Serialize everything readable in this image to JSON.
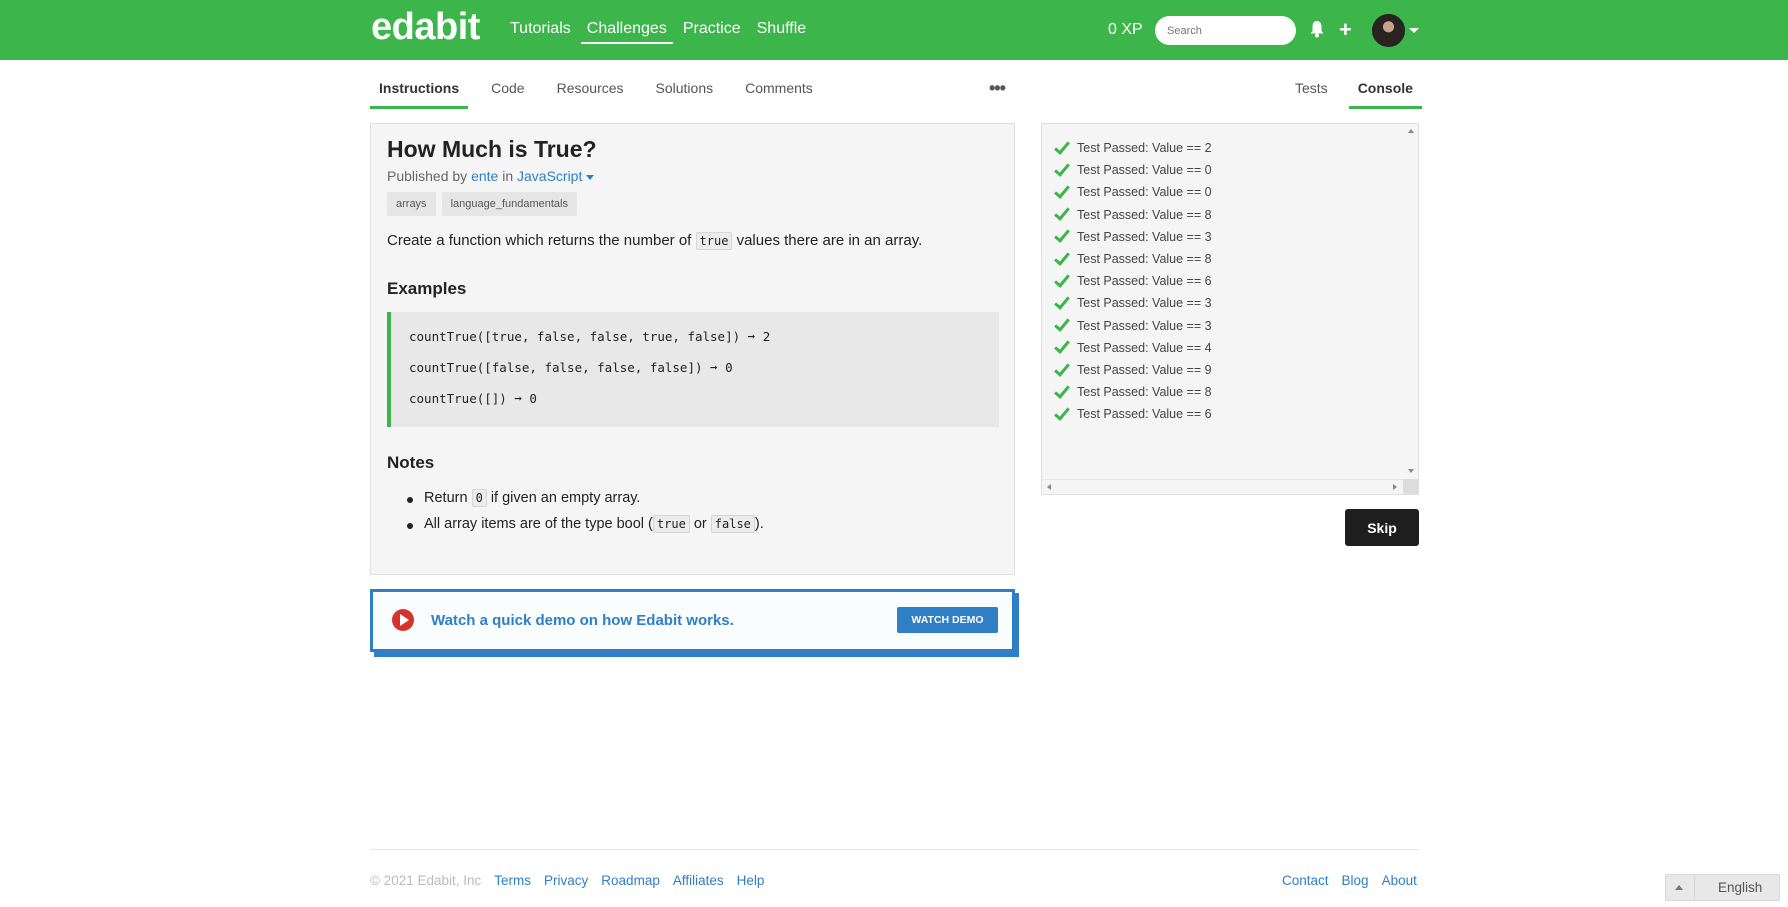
{
  "header": {
    "logo": "edabit",
    "nav": [
      {
        "label": "Tutorials"
      },
      {
        "label": "Challenges"
      },
      {
        "label": "Practice"
      },
      {
        "label": "Shuffle"
      }
    ],
    "active_nav": "Challenges",
    "xp": "0 XP",
    "search_placeholder": "Search",
    "plus": "+"
  },
  "tabs_left": [
    "Instructions",
    "Code",
    "Resources",
    "Solutions",
    "Comments"
  ],
  "tabs_right": [
    "Tests",
    "Console"
  ],
  "more": "•••",
  "challenge": {
    "title": "How Much is True?",
    "published_by": "Published by",
    "author": "ente",
    "in": "in",
    "language": "JavaScript",
    "tags": [
      "arrays",
      "language_fundamentals"
    ],
    "desc_pre": "Create a function which returns the number of",
    "desc_code": "true",
    "desc_post": "values there are in an array.",
    "examples_heading": "Examples",
    "examples": [
      "countTrue([true, false, false, true, false]) ➞ 2",
      "countTrue([false, false, false, false]) ➞ 0",
      "countTrue([]) ➞ 0"
    ],
    "notes_heading": "Notes",
    "note1_pre": "Return",
    "note1_code": "0",
    "note1_post": "if given an empty array.",
    "note2_pre": "All array items are of the type bool (",
    "note2_code1": "true",
    "note2_mid": "or",
    "note2_code2": "false",
    "note2_post": ")."
  },
  "demo": {
    "text": "Watch a quick demo on how Edabit works.",
    "button": "WATCH DEMO"
  },
  "console": {
    "results": [
      "Test Passed: Value == 2",
      "Test Passed: Value == 0",
      "Test Passed: Value == 0",
      "Test Passed: Value == 8",
      "Test Passed: Value == 3",
      "Test Passed: Value == 8",
      "Test Passed: Value == 6",
      "Test Passed: Value == 3",
      "Test Passed: Value == 3",
      "Test Passed: Value == 4",
      "Test Passed: Value == 9",
      "Test Passed: Value == 8",
      "Test Passed: Value == 6"
    ]
  },
  "skip_button": "Skip",
  "footer": {
    "copyright": "© 2021 Edabit, Inc",
    "left_links": [
      "Terms",
      "Privacy",
      "Roadmap",
      "Affiliates",
      "Help"
    ],
    "right_links": [
      "Contact",
      "Blog",
      "About"
    ],
    "language": "English"
  },
  "colors": {
    "brand_green": "#3cb54a",
    "link_blue": "#2e7fc6",
    "play_red": "#d5342c"
  }
}
